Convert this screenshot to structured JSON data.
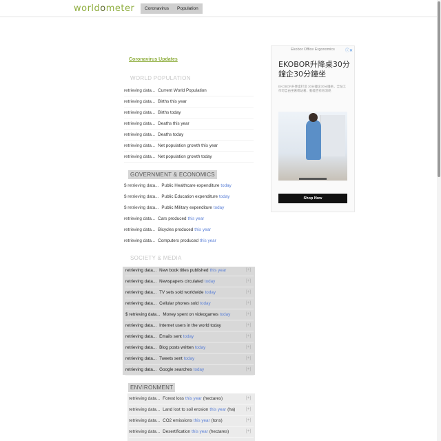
{
  "header": {
    "logo_left": "world",
    "logo_ring": "o",
    "logo_right": "meter",
    "nav": [
      "Coronavirus",
      "Population"
    ]
  },
  "coronavirus_link": "Coronavirus Updates",
  "sections": {
    "population": {
      "title": "WORLD POPULATION",
      "rows": [
        {
          "value": "retrieving data...",
          "label": "Current World Population",
          "period": ""
        },
        {
          "value": "retrieving data...",
          "label": "Births this year",
          "period": ""
        },
        {
          "value": "retrieving data...",
          "label": "Births today",
          "period": ""
        },
        {
          "value": "retrieving data...",
          "label": "Deaths this year",
          "period": ""
        },
        {
          "value": "retrieving data...",
          "label": "Deaths today",
          "period": ""
        },
        {
          "value": "retrieving data...",
          "label": "Net population growth this year",
          "period": ""
        },
        {
          "value": "retrieving data...",
          "label": "Net population growth today",
          "period": ""
        }
      ]
    },
    "government": {
      "title": "GOVERNMENT & ECONOMICS",
      "rows": [
        {
          "value": "$ retrieving data...",
          "label": "Public Healthcare expenditure",
          "period": "today"
        },
        {
          "value": "$ retrieving data...",
          "label": "Public Education expenditure",
          "period": "today"
        },
        {
          "value": "$ retrieving data...",
          "label": "Public Military expenditure",
          "period": "today"
        },
        {
          "value": "retrieving data...",
          "label": "Cars produced",
          "period": "this year"
        },
        {
          "value": "retrieving data...",
          "label": "Bicycles produced",
          "period": "this year"
        },
        {
          "value": "retrieving data...",
          "label": "Computers produced",
          "period": "this year"
        }
      ]
    },
    "society": {
      "title": "SOCIETY & MEDIA",
      "rows": [
        {
          "value": "retrieving data...",
          "label": "New book titles published",
          "period": "this year"
        },
        {
          "value": "retrieving data...",
          "label": "Newspapers circulated",
          "period": "today"
        },
        {
          "value": "retrieving data...",
          "label": "TV sets sold worldwide",
          "period": "today"
        },
        {
          "value": "retrieving data...",
          "label": "Cellular phones sold",
          "period": "today"
        },
        {
          "value": "$ retrieving data...",
          "label": "Money spent on videogames",
          "period": "today"
        },
        {
          "value": "retrieving data...",
          "label": "Internet users in the world today",
          "period": ""
        },
        {
          "value": "retrieving data...",
          "label": "Emails sent",
          "period": "today"
        },
        {
          "value": "retrieving data...",
          "label": "Blog posts written",
          "period": "today"
        },
        {
          "value": "retrieving data...",
          "label": "Tweets sent",
          "period": "today"
        },
        {
          "value": "retrieving data...",
          "label": "Google searches",
          "period": "today"
        }
      ]
    },
    "environment": {
      "title": "ENVIRONMENT",
      "rows": [
        {
          "value": "retrieving data...",
          "label": "Forest loss",
          "period": "this year",
          "suffix": "(hectares)"
        },
        {
          "value": "retrieving data...",
          "label": "Land lost to soil erosion",
          "period": "this year",
          "suffix": "(ha)"
        },
        {
          "value": "retrieving data...",
          "label": "CO2 emissions",
          "period": "this year",
          "suffix": "(tons)"
        },
        {
          "value": "retrieving data...",
          "label": "Desertification",
          "period": "this year",
          "suffix": "(hectares)"
        }
      ]
    }
  },
  "ad": {
    "advertiser": "Ekobor Office Ergonomics",
    "title": "EKOBOR升降桌30分鐘企30分鐘坐",
    "text": "EKOBOR升降桌打造 30分鐘企30分鐘坐，全站工作可自由坐著或站著，動能百有效消耗",
    "cta": "Shop Now",
    "close_glyph": "ⓘ✕"
  },
  "colors": {
    "brand": "#8fae3f",
    "period_link": "#5a7fd6",
    "society_bg": "#d8d8d8"
  }
}
